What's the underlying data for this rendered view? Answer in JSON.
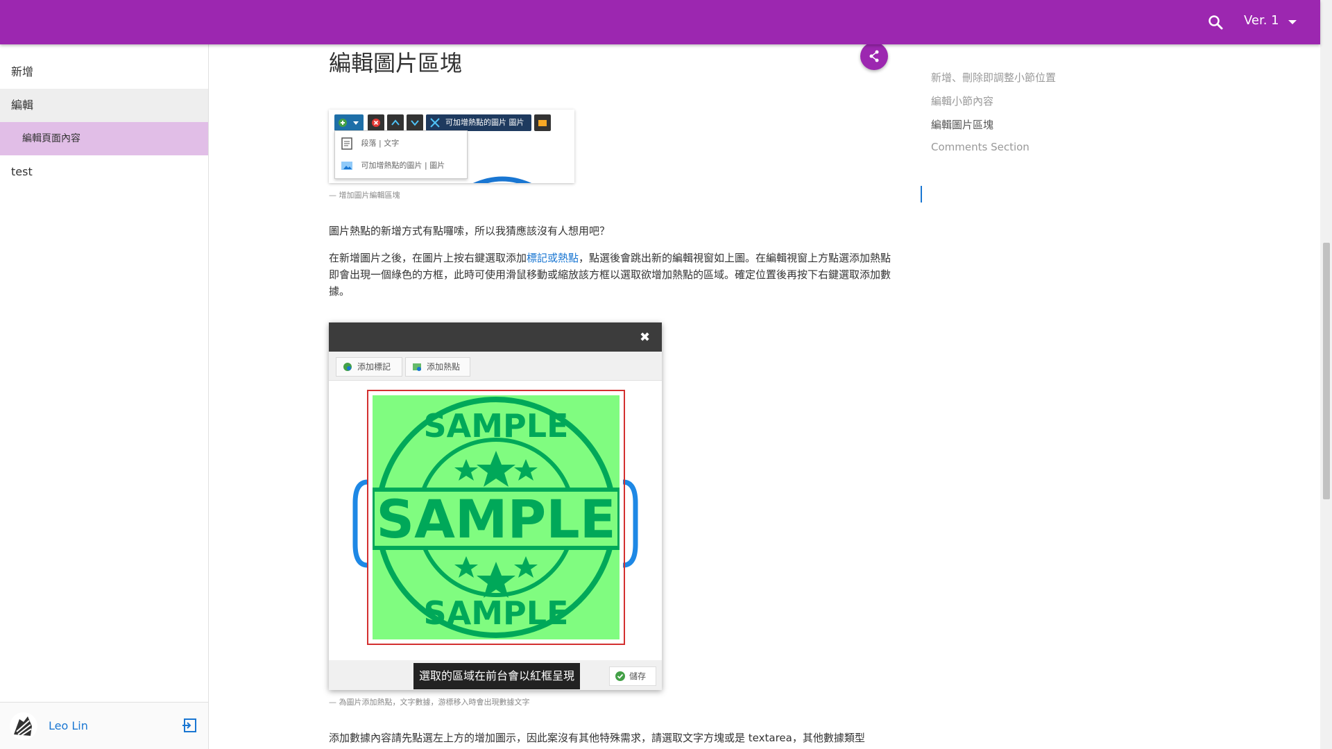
{
  "topbar": {
    "version": "Ver. 1",
    "bg_color": "#9c27b0"
  },
  "sidebar": {
    "items": [
      {
        "label": "新增"
      },
      {
        "label": "編輯"
      },
      {
        "label": "編輯頁面內容"
      },
      {
        "label": "test"
      }
    ],
    "user": {
      "name": "Leo Lin"
    }
  },
  "main": {
    "title": "編輯圖片區塊",
    "figure1": {
      "toolbar_label": "可加增熱點的圖片 圖片",
      "menu_items": [
        "段落 | 文字",
        "可加增熱點的圖片 | 圖片"
      ],
      "caption": "— 增加圖片編輯區塊"
    },
    "para1": "圖片熱點的新增方式有點囉嗦，所以我猜應該沒有人想用吧？",
    "para2_pre": "在新增圖片之後，在圖片上按右鍵選取添加",
    "para2_link": "標記或熱點",
    "para2_post": "，點選後會跳出新的編輯視窗如上圖。在編輯視窗上方點選添加熱點即會出現一個綠色的方框，此時可使用滑鼠移動或縮放該方框以選取欲增加熱點的區域。確定位置後再按下右鍵選取添加數據。",
    "figure2": {
      "add_marker": "添加標記",
      "add_hotspot": "添加熱點",
      "stamp_text_big": "SAMPLE",
      "stamp_text_top": "SAMPLE",
      "stamp_text_bottom": "SAMPLE",
      "tooltip": "選取的區域在前台會以紅框呈現",
      "save": "儲存",
      "caption": "— 為圖片添加熱點，文字數據，游標移入時會出現數據文字"
    },
    "para3": "添加數據內容請先點選左上方的增加圖示，因此案沒有其他特殊需求，請選取文字方塊或是 textarea，其他數據類型"
  },
  "toc": {
    "items": [
      {
        "label": "新增、刪除即調整小節位置"
      },
      {
        "label": "編輯小節內容"
      },
      {
        "label": "編輯圖片區塊"
      },
      {
        "label": "Comments Section"
      }
    ]
  }
}
